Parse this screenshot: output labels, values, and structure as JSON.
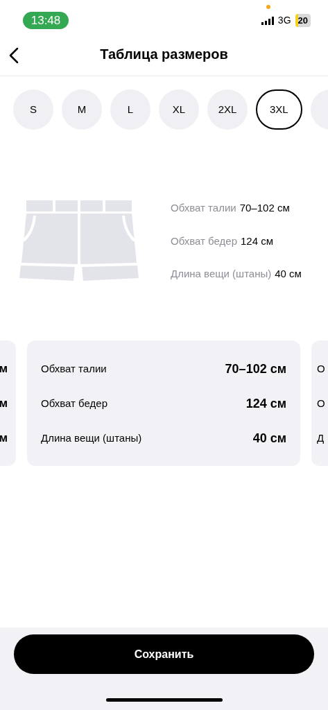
{
  "status_bar": {
    "time": "13:48",
    "network": "3G",
    "battery": "20"
  },
  "header": {
    "title": "Таблица размеров"
  },
  "sizes": [
    {
      "label": "S",
      "selected": false
    },
    {
      "label": "M",
      "selected": false
    },
    {
      "label": "L",
      "selected": false
    },
    {
      "label": "XL",
      "selected": false
    },
    {
      "label": "2XL",
      "selected": false
    },
    {
      "label": "3XL",
      "selected": true
    }
  ],
  "summary": [
    {
      "label": "Обхват талии",
      "value": "70–102 см"
    },
    {
      "label": "Обхват бедер",
      "value": "124 см"
    },
    {
      "label": "Длина вещи (штаны)",
      "value": "40 см"
    }
  ],
  "prev_card": {
    "values": [
      "м",
      "м",
      "м"
    ]
  },
  "card": {
    "rows": [
      {
        "label": "Обхват талии",
        "value": "70–102 см"
      },
      {
        "label": "Обхват бедер",
        "value": "124 см"
      },
      {
        "label": "Длина вещи (штаны)",
        "value": "40 см"
      }
    ]
  },
  "next_card": {
    "labels": [
      "О",
      "О",
      "Д"
    ]
  },
  "save_button": "Сохранить"
}
